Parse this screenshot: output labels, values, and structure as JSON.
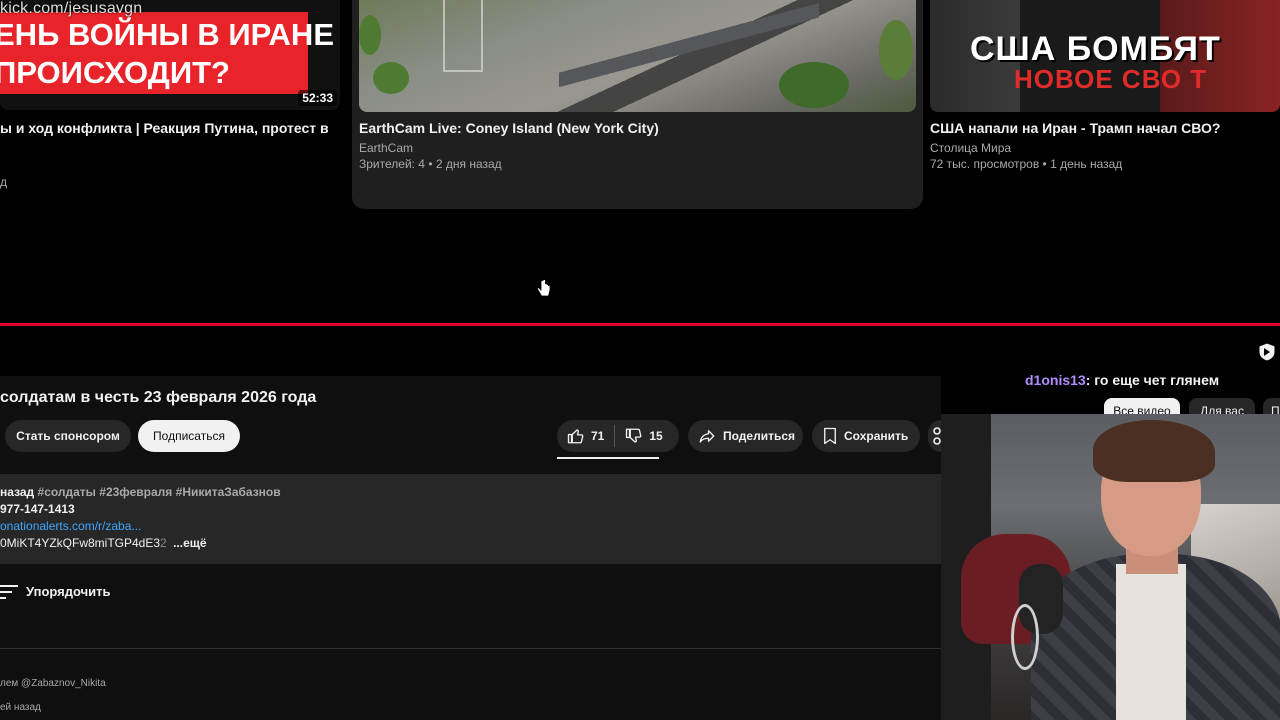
{
  "recommendations": [
    {
      "watermark": "kick.com/jesusavgn",
      "thumb_lines": [
        "ЕНЬ ВОЙНЫ В ИРАНЕ",
        "ПРОИСХОДИТ?"
      ],
      "duration": "52:33",
      "title": "ы и ход конфликта | Реакция Путина, протест в",
      "meta": "д"
    },
    {
      "title": "EarthCam Live: Coney Island (New York City)",
      "channel": "EarthCam",
      "meta": "Зрителей: 4 • 2 дня назад"
    },
    {
      "thumb_line1": "США БОМБЯТ",
      "thumb_line2": "НОВОЕ СВО Т",
      "title": "США напали на Иран - Трамп начал СВО?",
      "channel": "Столица Мира",
      "meta": "72 тыс. просмотров • 1 день назад"
    }
  ],
  "video": {
    "title": "солдатам в честь 23 февраля 2026 года",
    "sponsor_label": "Стать спонсором",
    "subscribe_label": "Подписаться",
    "likes": "71",
    "dislikes": "15",
    "share_label": "Поделиться",
    "save_label": "Сохранить"
  },
  "description": {
    "time": "назад",
    "hashtags": "#солдаты #23февраля #НикитаЗабазнов",
    "line2": "977-147-1413",
    "link": "onationalerts.com/r/zaba...",
    "line4": "0MiKT4YZkQFw8miTGP4dE3",
    "line4_fade": "2",
    "more_label": "...ещё"
  },
  "comments": {
    "sort_label": "Упорядочить",
    "pinned_meta": "лем @Zabaznov_Nikita",
    "time_meta": "ей назад"
  },
  "chat": {
    "user": "d1onis13",
    "message": ": го еще чет глянем"
  },
  "filter_chips": [
    "Все видео",
    "Для вас",
    "П"
  ],
  "colors": {
    "accent_red": "#e1002d",
    "link_blue": "#3ea6ff",
    "chat_user": "#b28cff"
  }
}
